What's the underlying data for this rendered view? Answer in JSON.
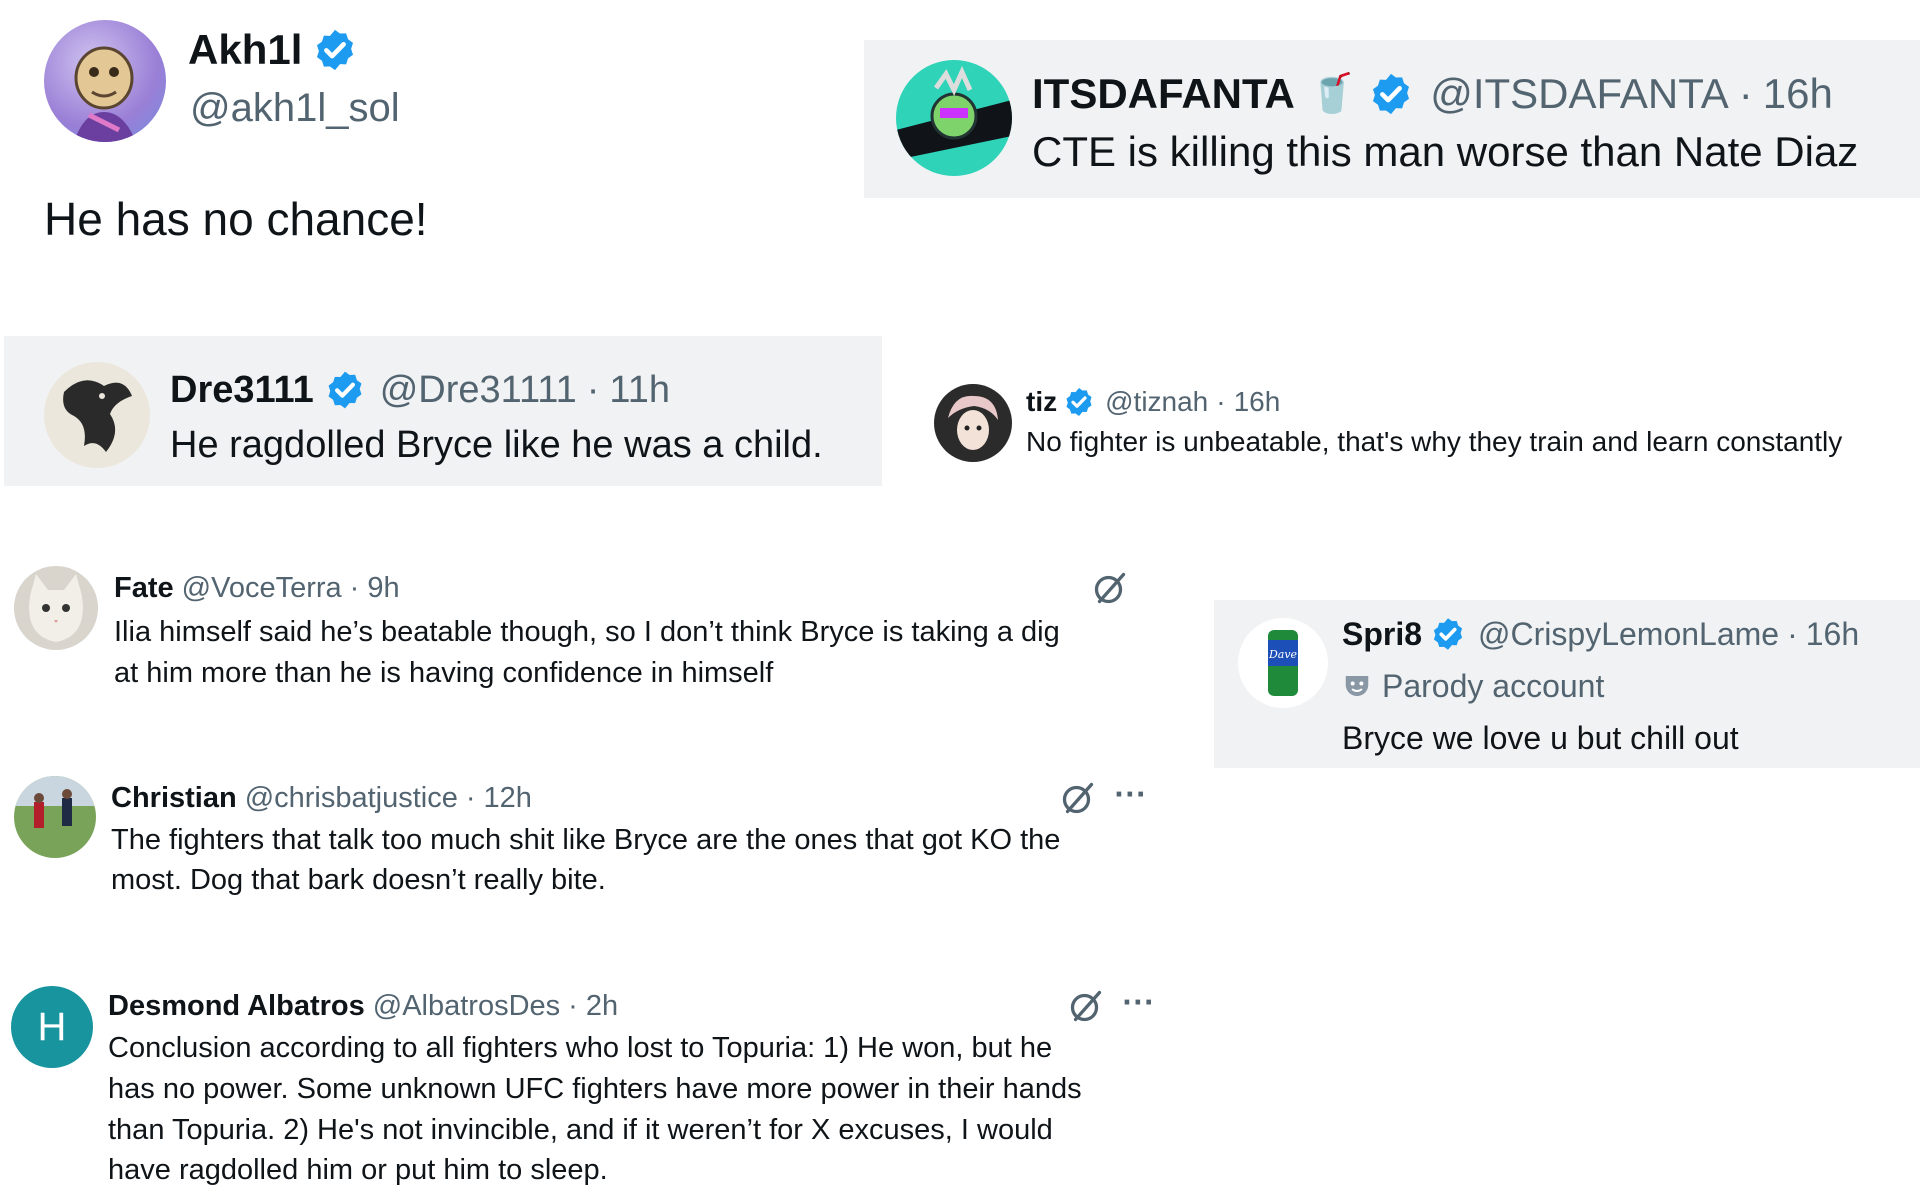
{
  "tweets": {
    "akh1l": {
      "name": "Akh1l",
      "handle": "@akh1l_sol",
      "text": "He has no chance!"
    },
    "itsdafanta": {
      "name": "ITSDAFANTA",
      "emoji": "🥤",
      "handle": "@ITSDAFANTA",
      "sep": "·",
      "time": "16h",
      "text": "CTE is killing this man worse than Nate Diaz"
    },
    "dre": {
      "name": "Dre3111",
      "handle": "@Dre31111",
      "sep": "·",
      "time": "11h",
      "text": "He ragdolled Bryce like he was a child."
    },
    "tiz": {
      "name": "tiz",
      "handle": "@tiznah",
      "sep": "·",
      "time": "16h",
      "text": "No fighter is unbeatable, that's why they train and learn constantly"
    },
    "fate": {
      "name": "Fate",
      "handle": "@VoceTerra",
      "sep": "·",
      "time": "9h",
      "line1": "Ilia himself said he’s beatable though, so I don’t think Bryce is taking a dig",
      "line2": "at him more than he is having confidence in himself"
    },
    "spri8": {
      "name": "Spri8",
      "handle": "@CrispyLemonLame",
      "sep": "·",
      "time": "16h",
      "label": "Parody account",
      "text": "Bryce we love u but chill out",
      "can_text": "Dave"
    },
    "christian": {
      "name": "Christian",
      "handle": "@chrisbatjustice",
      "sep": "·",
      "time": "12h",
      "line1": "The fighters that talk too much shit like Bryce are the ones that got KO the",
      "line2": "most. Dog that bark doesn’t really bite.",
      "more": "···"
    },
    "desmond": {
      "name": "Desmond Albatros",
      "handle": "@AlbatrosDes",
      "sep": "·",
      "time": "2h",
      "avatar_letter": "H",
      "line1": "Conclusion according to all fighters who lost to Topuria: 1) He won, but he",
      "line2": "has no power. Some unknown UFC fighters have more power in their hands",
      "line3": "than Topuria. 2) He's not invincible, and if it weren’t for X excuses, I would",
      "line4": "have ragdolled him or put him to sleep.",
      "more": "···"
    }
  },
  "colors": {
    "verified": "#1d9bf0",
    "muted": "#536471",
    "panel": "#f1f2f3",
    "teal_avatar": "#17949e"
  }
}
